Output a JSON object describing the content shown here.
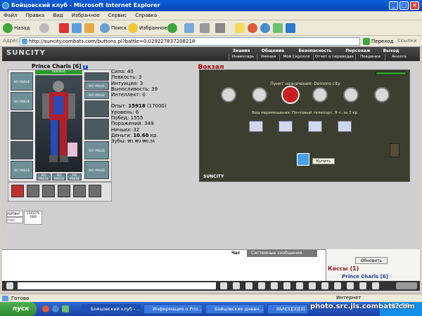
{
  "window": {
    "title": "Бойцовский клуб - Microsoft Internet Explorer"
  },
  "menu": [
    "Файл",
    "Правка",
    "Вид",
    "Избранное",
    "Сервис",
    "Справка"
  ],
  "toolbar": {
    "back": "Назад",
    "search": "Поиск",
    "favorites": "Избранное"
  },
  "address": {
    "label": "Адрес:",
    "url": "http://suncity.combats.com/buttons.pl?battle=0.029227837208218",
    "go": "Переход",
    "links": "Ссылки"
  },
  "game": {
    "logo": "SUNCITY",
    "nav_top": [
      "Знания",
      "Общение",
      "Безопасность",
      "Персонаж",
      "Выход"
    ],
    "nav_bottom": [
      "Инвентарь",
      "Умения",
      "Мой Скроллл",
      "Отчет о переводах",
      "Поединки",
      "Анкета"
    ]
  },
  "character": {
    "name": "Prince Charls [6]",
    "level_badge": "i",
    "hp": "604/604",
    "slot_label": "NO IMAGE",
    "stats": [
      {
        "label": "Сила:",
        "value": "40"
      },
      {
        "label": "Ловкость:",
        "value": "3"
      },
      {
        "label": "Интуиция:",
        "value": "3"
      },
      {
        "label": "Выносливость:",
        "value": "39"
      },
      {
        "label": "Интеллект:",
        "value": "0"
      }
    ],
    "exp_label": "Опыт:",
    "exp_value": "15918",
    "exp_next": "(17000)",
    "level_label": "Уровень:",
    "level_value": "6",
    "wins_label": "Побед:",
    "wins_value": "1555",
    "losses_label": "Поражений:",
    "losses_value": "349",
    "draws_label": "Ничьих:",
    "draws_value": "32",
    "money_label": "Деньги:",
    "money_value": "10.60",
    "money_unit": "кр.",
    "teeth_label": "Зубы:",
    "teeth_value": "₩1 ₩2 ₩0.36"
  },
  "counters": {
    "c1": "РЕЙТИНГ 5243565",
    "c2": "mail",
    "c3a": "2145379",
    "c3b": "1600"
  },
  "vokzal": {
    "title": "Вокзал",
    "destination": "Пункт назначения: Demons city",
    "travel": "Вид перемещения: Почтовый телепорт, 9 ч. за 2 кр.",
    "buy": "Купить",
    "logo": "SUNCITY"
  },
  "chat": {
    "tab_chat": "Чат",
    "tab_system": "Системные сообщения",
    "refresh": "Обновить",
    "kassy": "Кассы (1)",
    "player": "Prince Charls [6]"
  },
  "status": {
    "ready": "Готово",
    "internet": "Интернет"
  },
  "taskbar": {
    "start": "пуск",
    "tasks": [
      "Бойцовский клуб - ...",
      "Информация о Prin...",
      "Бойцовские дневн...",
      "Il&h[5][3][3] - ..."
    ],
    "clock": "07:56"
  },
  "watermark": "photo.src.jls.combats.com"
}
